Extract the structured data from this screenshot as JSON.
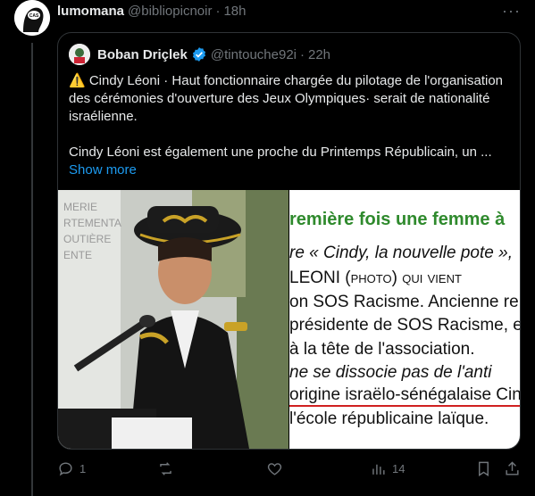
{
  "tweet": {
    "display_name": "lumomana",
    "handle": "@bibliopicnoir",
    "separator": "·",
    "time": "18h",
    "more_label": "···"
  },
  "quoted": {
    "display_name": "Boban Driçlek",
    "handle": "@tintouche92i",
    "separator": "·",
    "time": "22h",
    "para1": "⚠️ Cindy Léoni · Haut fonctionnaire chargée du pilotage de l'organisation des cérémonies d'ouverture des Jeux Olympiques· serait de nationalité israélienne.",
    "para2": "Cindy Léoni est également une proche du Printemps Républicain, un ...",
    "show_more": "Show more",
    "photo_sign": [
      "MERIE",
      "RTEMENTA",
      "OUTIÈRE",
      "ENTE"
    ],
    "clip_lines": [
      "remière fois une femme à",
      "re « Cindy, la nouvelle pote »,",
      "LEONI (photo) qui vient",
      "on SOS Racisme. Ancienne re",
      "présidente de SOS Racisme, el",
      "à la tête de l'association.",
      "ne se dissocie pas de l'anti",
      "origine israëlo-sénégalaise Cin",
      "l'école républicaine laïque."
    ]
  },
  "actions": {
    "replies": "1",
    "retweets": "",
    "likes": "",
    "views": "14"
  },
  "colors": {
    "accent": "#1d9bf0",
    "muted": "#71767b",
    "border": "#2f3336"
  }
}
